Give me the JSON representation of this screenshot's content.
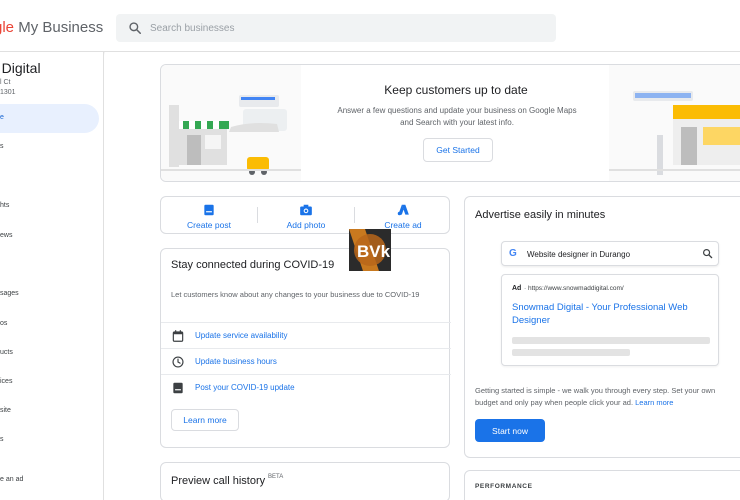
{
  "app": {
    "brand_prefix": "gle",
    "brand_suffix": " My Business"
  },
  "search": {
    "placeholder": "Search businesses"
  },
  "sidebar": {
    "business_name": "d Digital",
    "address_line1": "l Ct",
    "address_line2": "1301",
    "items": [
      {
        "label": "e"
      },
      {
        "label": "s"
      },
      {
        "label": "hts"
      },
      {
        "label": "ews"
      },
      {
        "label": "sages"
      },
      {
        "label": "os"
      },
      {
        "label": "ucts"
      },
      {
        "label": "ices"
      },
      {
        "label": "site"
      },
      {
        "label": "s"
      },
      {
        "label": "e an ad"
      }
    ]
  },
  "hero": {
    "title": "Keep customers up to date",
    "description": "Answer a few questions and update your business on Google Maps and Search with your latest info.",
    "button": "Get Started"
  },
  "actions": {
    "create_post": "Create post",
    "add_photo": "Add photo",
    "create_ad": "Create ad"
  },
  "covid": {
    "title": "Stay connected during COVID-19",
    "description": "Let customers know about any changes to your business due to COVID-19",
    "rows": [
      {
        "label": "Update service availability",
        "icon": "calendar-icon"
      },
      {
        "label": "Update business hours",
        "icon": "clock-icon"
      },
      {
        "label": "Post your COVID-19 update",
        "icon": "post-icon"
      }
    ],
    "learn_more": "Learn more"
  },
  "preview": {
    "title": "Preview call history",
    "badge": "BETA"
  },
  "advertise": {
    "title": "Advertise easily in minutes",
    "mini_search_query": "Website designer in Durango",
    "ad_label": "Ad",
    "ad_url": "· https://www.snowmaddigital.com/",
    "ad_headline": "Snowmad Digital - Your Professional Web Designer",
    "description": "Getting started is simple - we walk you through every step. Set your own budget and only pay when people click your ad.",
    "learn_more_link": "Learn more",
    "button": "Start now"
  },
  "performance": {
    "title": "PERFORMANCE"
  },
  "colors": {
    "accent": "#1a73e8",
    "active_nav_bg": "#e8f0fe",
    "border": "#dadce0"
  }
}
